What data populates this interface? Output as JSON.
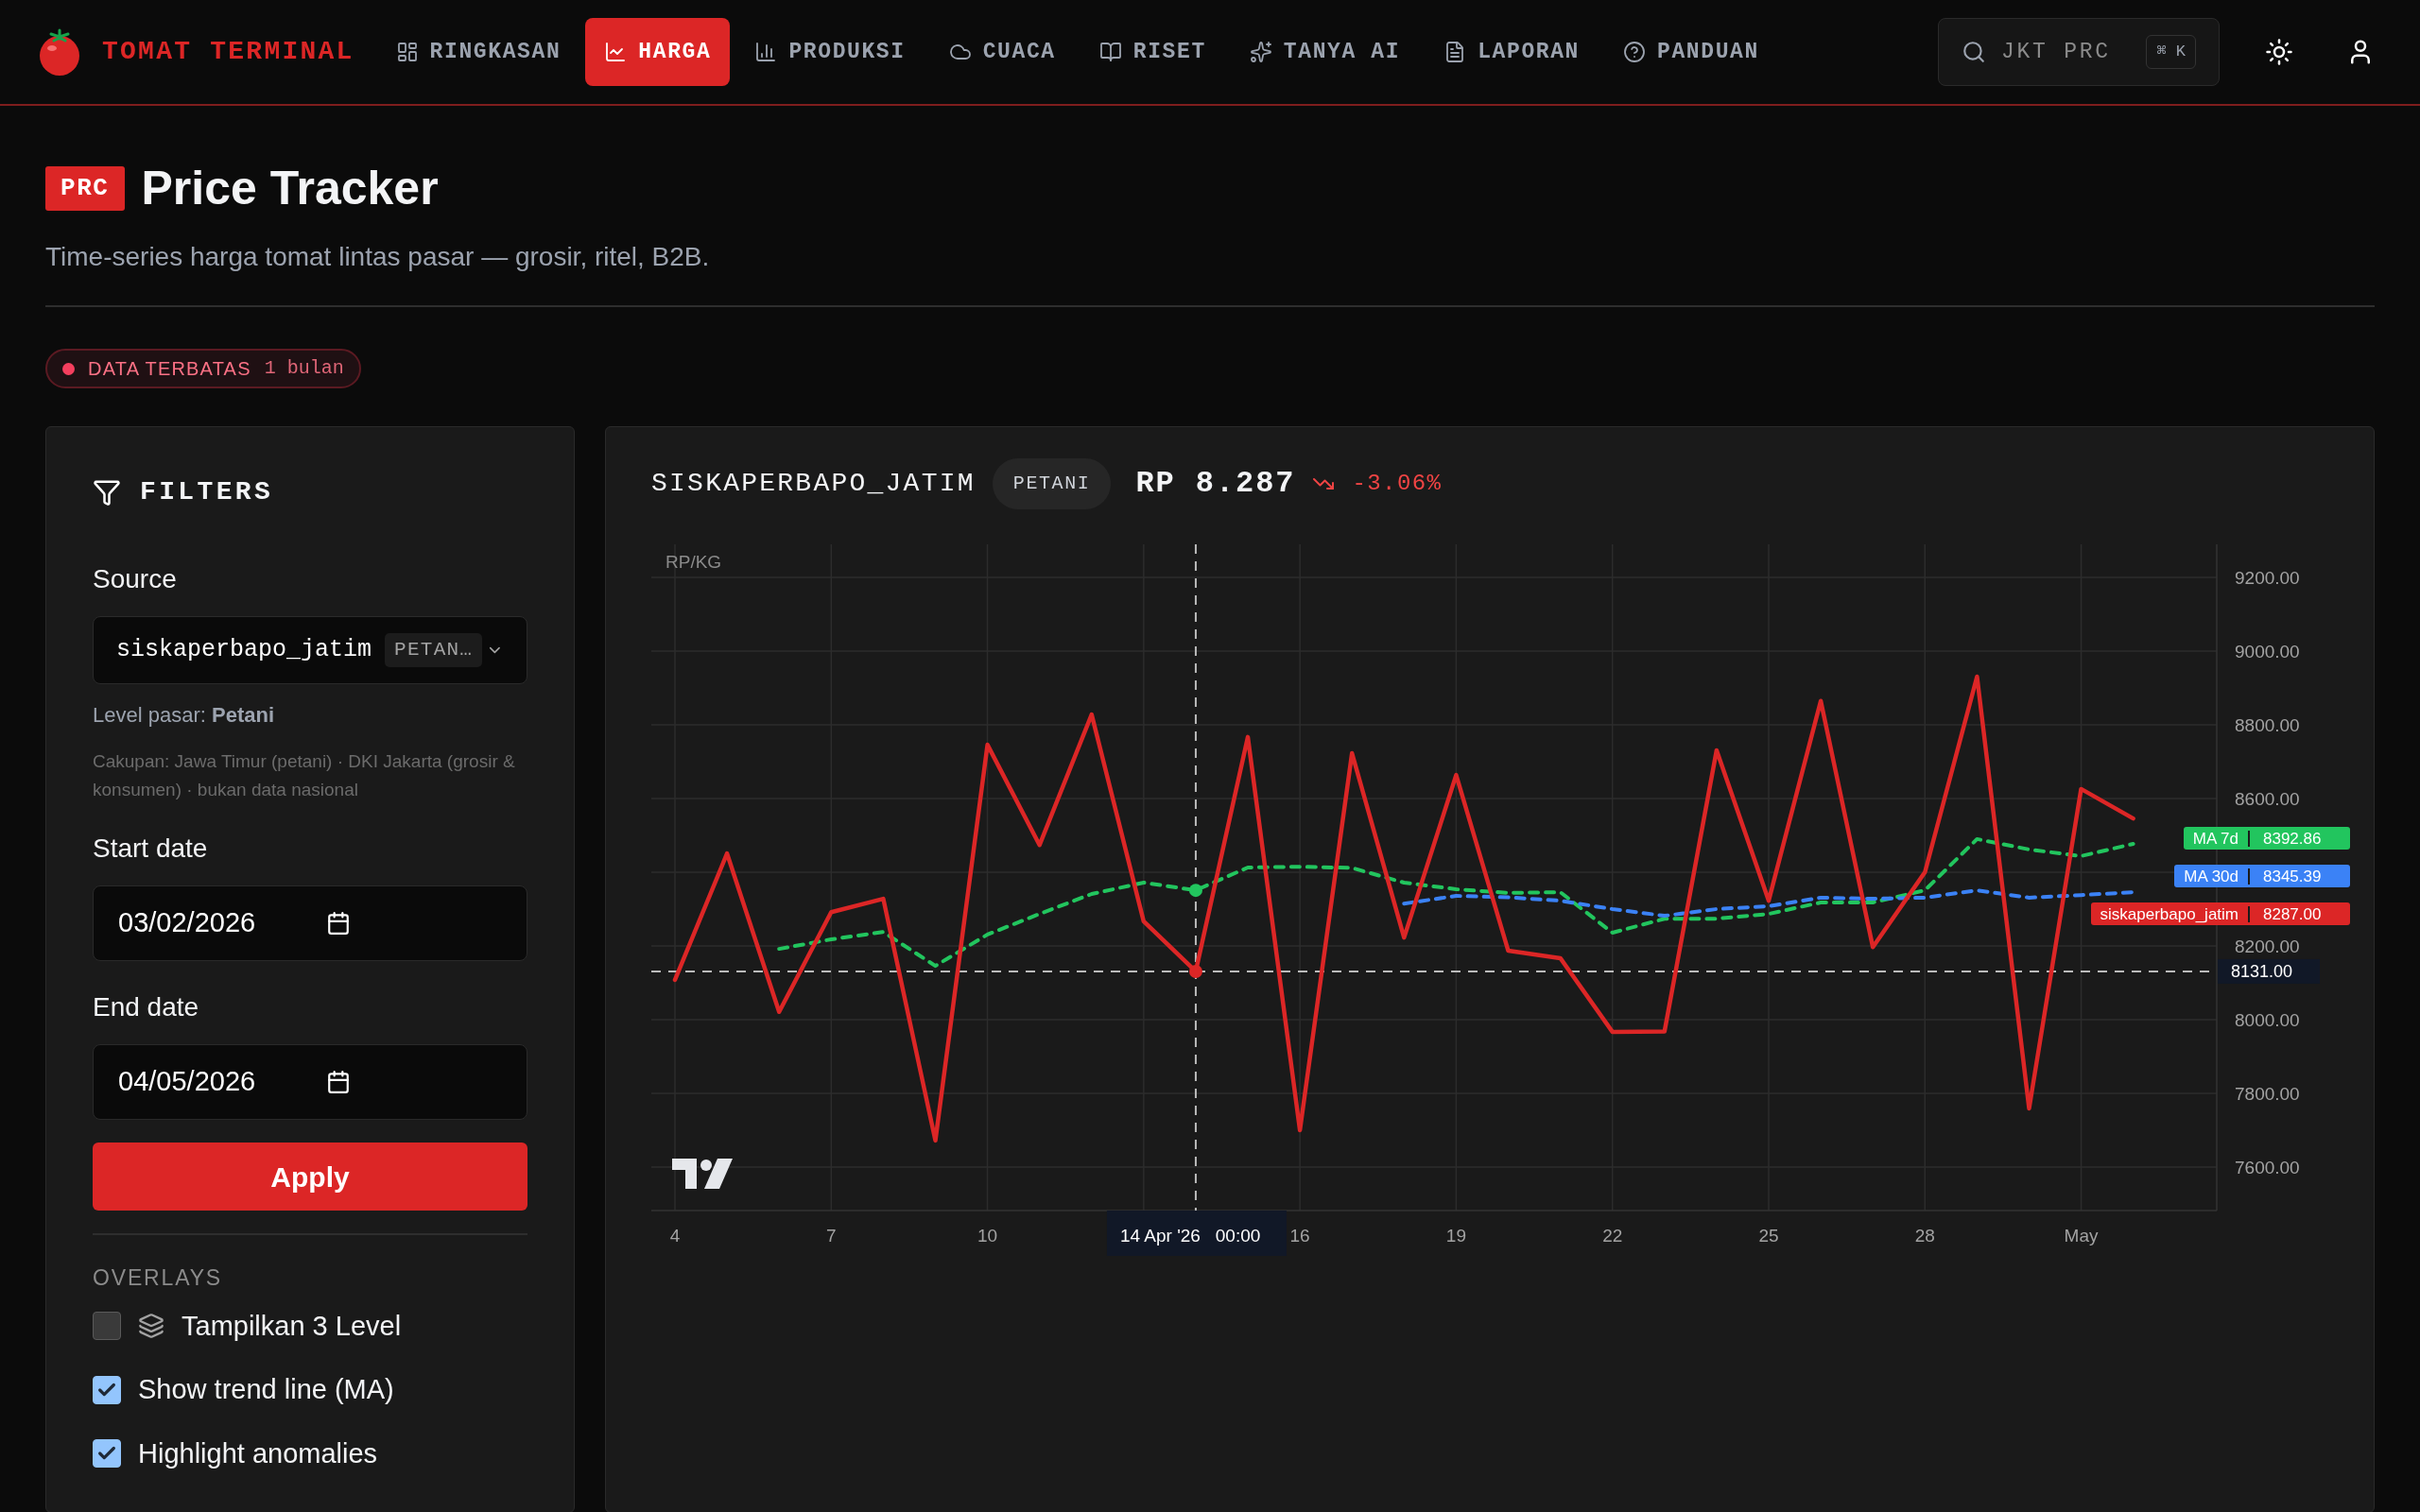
{
  "app": {
    "name": "TOMAT TERMINAL"
  },
  "nav": [
    {
      "label": "RINGKASAN",
      "selected": false
    },
    {
      "label": "HARGA",
      "selected": true
    },
    {
      "label": "PRODUKSI",
      "selected": false
    },
    {
      "label": "CUACA",
      "selected": false
    },
    {
      "label": "RISET",
      "selected": false
    },
    {
      "label": "TANYA AI",
      "selected": false
    },
    {
      "label": "LAPORAN",
      "selected": false
    },
    {
      "label": "PANDUAN",
      "selected": false
    }
  ],
  "search": {
    "placeholder": "JKT PRC",
    "shortcut": "⌘ K"
  },
  "page": {
    "badge": "PRC",
    "title": "Price Tracker",
    "subtitle": "Time-series harga tomat lintas pasar — grosir, ritel, B2B."
  },
  "notice": {
    "label": "DATA TERBATAS",
    "value": "1 bulan"
  },
  "filters": {
    "title": "FILTERS",
    "source": {
      "label": "Source",
      "value": "siskaperbapo_jatim",
      "tag": "PETAN…"
    },
    "level_note": "Level pasar: **Petani**",
    "coverage": "Cakupan: Jawa Timur (petani) · DKI Jakarta (grosir & konsumen) · bukan data nasional",
    "start": {
      "label": "Start date",
      "value": "03/02/2026"
    },
    "end": {
      "label": "End date",
      "value": "04/05/2026"
    },
    "apply": "Apply",
    "overlays_title": "OVERLAYS",
    "overlays": [
      {
        "label": "Tampilkan 3 Level",
        "checked": false,
        "kind": "layers"
      },
      {
        "label": "Show trend line (MA)",
        "checked": true,
        "kind": "plain"
      },
      {
        "label": "Highlight anomalies",
        "checked": true,
        "kind": "plain"
      }
    ]
  },
  "chart_panel": {
    "source": "SISKAPERBAPO_JATIM",
    "level": "PETANI",
    "price": "RP 8.287",
    "change": "-3.06%",
    "chart_data": {
      "type": "line",
      "ylabel": "RP/KG",
      "grid": true,
      "legend": "right",
      "categories": [
        "4",
        null,
        null,
        "7",
        null,
        null,
        "10",
        null,
        null,
        null,
        null,
        null,
        "16",
        null,
        null,
        "19",
        null,
        null,
        "22",
        null,
        null,
        "25",
        null,
        null,
        "28",
        null,
        null,
        "May",
        null,
        null
      ],
      "ylim": [
        7482,
        9290
      ],
      "yticks": [
        {
          "value": 9200,
          "label": "9200.00"
        },
        {
          "value": 9000,
          "label": "9000.00"
        },
        {
          "value": 8800,
          "label": "8800.00"
        },
        {
          "value": 8600,
          "label": "8600.00"
        },
        {
          "value": 8200,
          "label": "8200.00"
        },
        {
          "value": 8000,
          "label": "8000.00"
        },
        {
          "value": 7800,
          "label": "7800.00"
        },
        {
          "value": 7600,
          "label": "7600.00"
        }
      ],
      "series": [
        {
          "name": "MA 7d",
          "color": "#22c55e",
          "line_style": "dashed",
          "values": [
            null,
            null,
            8192,
            8218,
            8238,
            8146,
            8231,
            8287,
            8341,
            8372,
            8351,
            8413,
            8415,
            8412,
            8372,
            8354,
            8344,
            8346,
            8236,
            8274,
            8274,
            8287,
            8318,
            8318,
            8351,
            8490,
            8462,
            8444,
            8477,
            null
          ]
        },
        {
          "name": "MA 30d",
          "color": "#3b82f6",
          "line_style": "dashed",
          "values": [
            null,
            null,
            null,
            null,
            null,
            null,
            null,
            null,
            null,
            null,
            null,
            null,
            null,
            null,
            8315,
            8336,
            8332,
            8323,
            8300,
            8282,
            8300,
            8308,
            8331,
            8328,
            8331,
            8351,
            8331,
            8338,
            8346,
            null
          ]
        },
        {
          "name": "siskaperbapo_jatim",
          "color": "#dc2626",
          "line_style": "solid",
          "values": [
            8108,
            8451,
            8021,
            8292,
            8328,
            7672,
            8746,
            8474,
            8828,
            8267,
            8131,
            8767,
            7700,
            8723,
            8223,
            8664,
            8187,
            8167,
            7967,
            7968,
            8731,
            8323,
            8865,
            8197,
            8400,
            8931,
            7759,
            8626,
            8546,
            null
          ]
        }
      ],
      "ref_lines": [
        {
          "axis": "y",
          "value": 8131,
          "label": "8131.00"
        }
      ],
      "annotations": [
        "14 Apr '26   00:00",
        "8392.86",
        "8345.39",
        "8287.00"
      ]
    }
  }
}
